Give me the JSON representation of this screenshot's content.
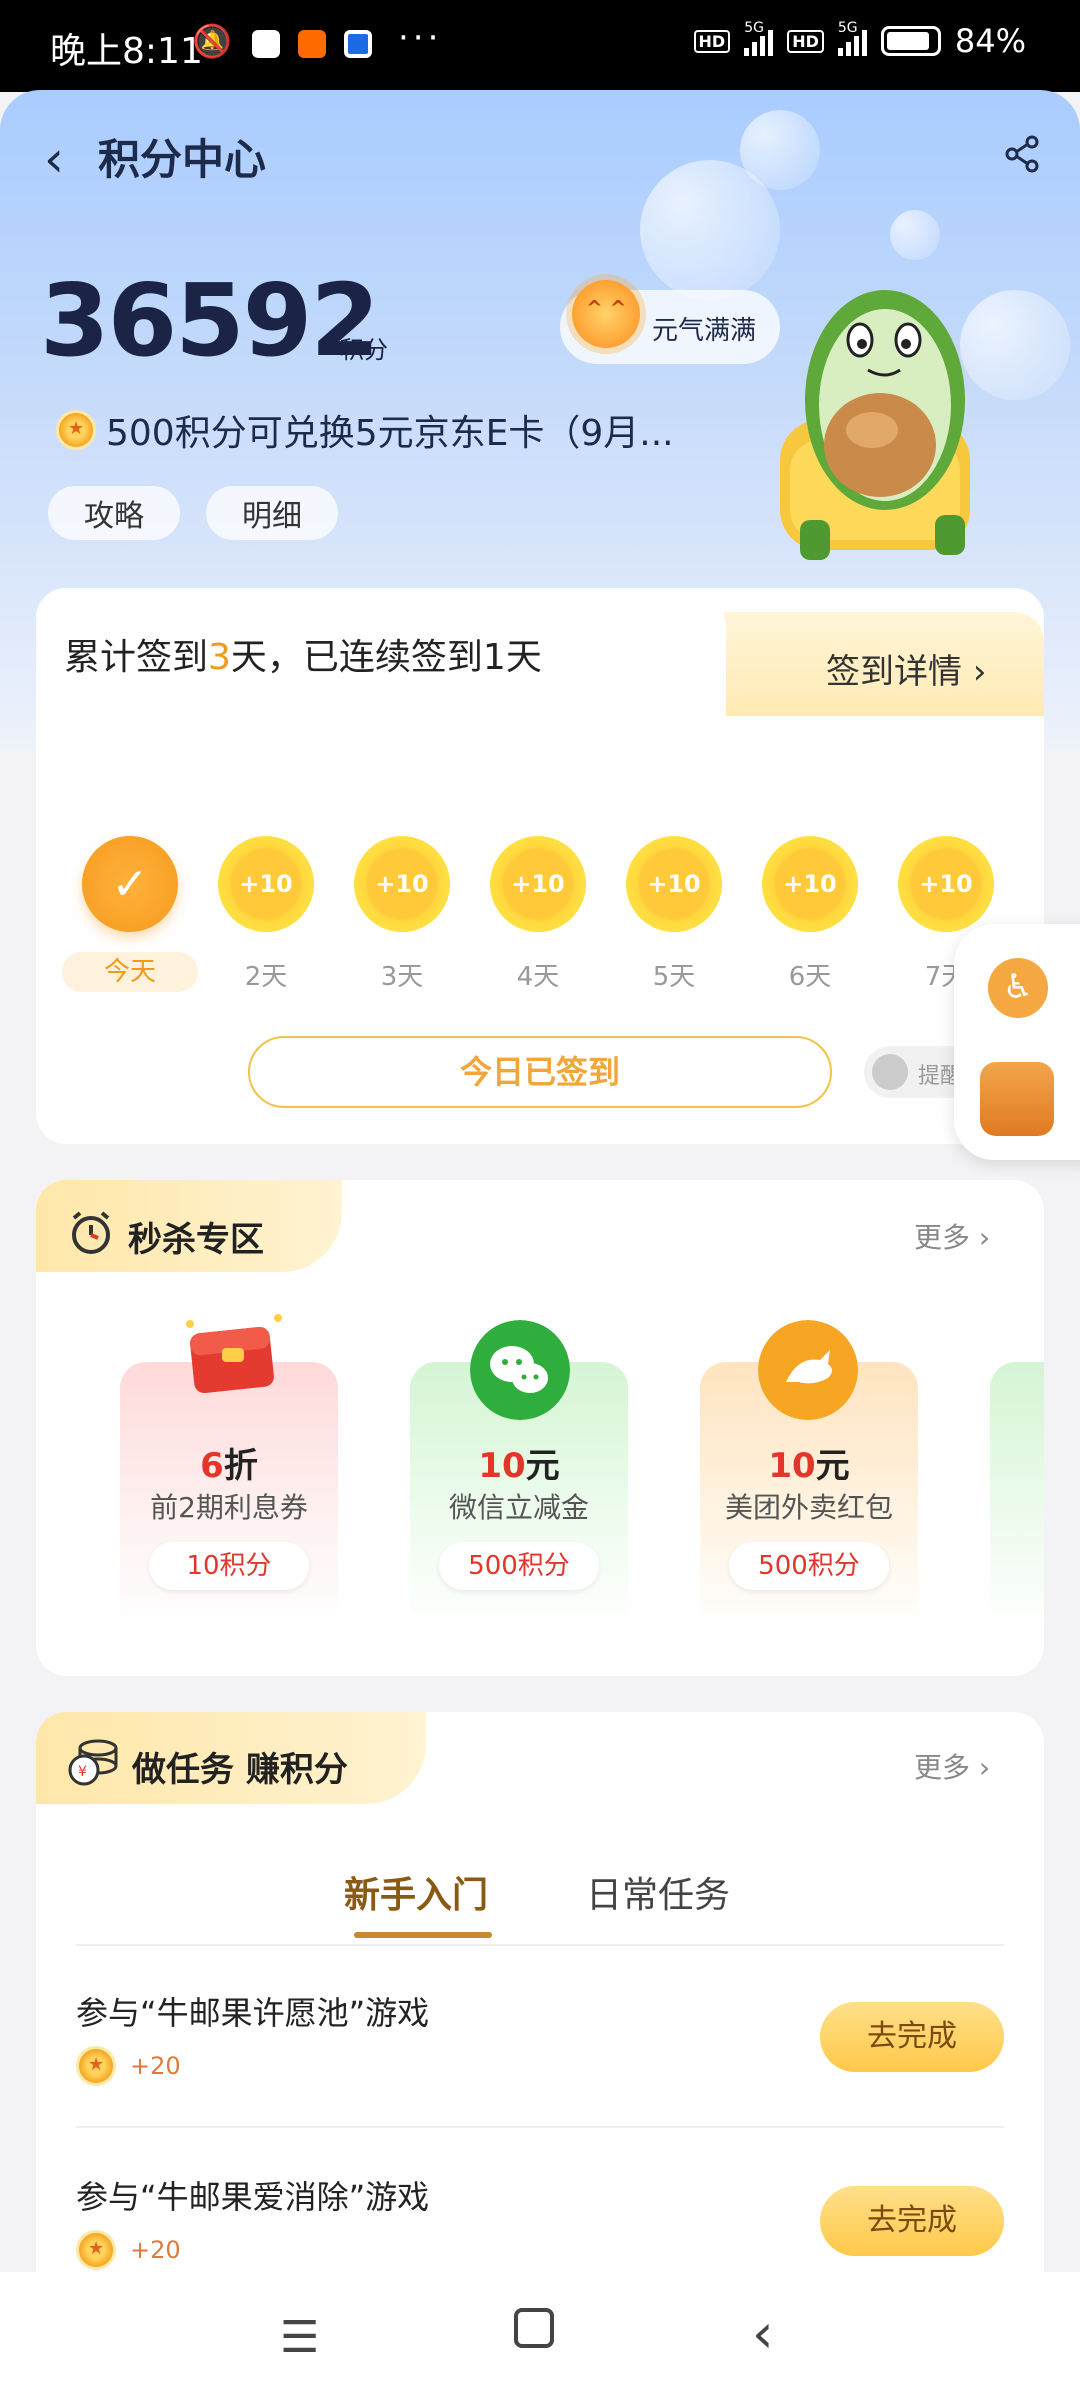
{
  "status_bar": {
    "time": "晚上8:11",
    "battery": "84%",
    "network1": "5G",
    "network2": "5G",
    "hd": "HD"
  },
  "header": {
    "title": "积分中心",
    "points": "36592",
    "points_unit": "积分",
    "mood": "元气满满",
    "promo": "500积分可兑换5元京东E卡（9月...",
    "pills": [
      "攻略",
      "明细"
    ]
  },
  "signin": {
    "text_prefix": "累计签到",
    "days_total": "3",
    "text_suffix": "天，已连续签到1天",
    "detail": "签到详情",
    "days": [
      {
        "label": "今天",
        "reward": "",
        "done": true
      },
      {
        "label": "2天",
        "reward": "+10",
        "done": false
      },
      {
        "label": "3天",
        "reward": "+10",
        "done": false
      },
      {
        "label": "4天",
        "reward": "+10",
        "done": false
      },
      {
        "label": "5天",
        "reward": "+10",
        "done": false
      },
      {
        "label": "6天",
        "reward": "+10",
        "done": false
      },
      {
        "label": "7天",
        "reward": "+10",
        "done": false
      }
    ],
    "button": "今日已签到",
    "remind": "提醒"
  },
  "flash_sale": {
    "title": "秒杀专区",
    "more": "更多",
    "items": [
      {
        "amount": "6",
        "unit": "折",
        "desc": "前2期利息券",
        "cost": "10积分"
      },
      {
        "amount": "10",
        "unit": "元",
        "desc": "微信立减金",
        "cost": "500积分"
      },
      {
        "amount": "10",
        "unit": "元",
        "desc": "美团外卖红包",
        "cost": "500积分"
      }
    ]
  },
  "tasks": {
    "title": "做任务 赚积分",
    "more": "更多",
    "tabs": [
      "新手入门",
      "日常任务"
    ],
    "items": [
      {
        "title": "参与“牛邮果许愿池”游戏",
        "reward": "+20",
        "button": "去完成"
      },
      {
        "title": "参与“牛邮果爱消除”游戏",
        "reward": "+20",
        "button": "去完成"
      }
    ]
  },
  "colors": {
    "accent": "#f29a13",
    "deal_red": "#e3362b"
  }
}
